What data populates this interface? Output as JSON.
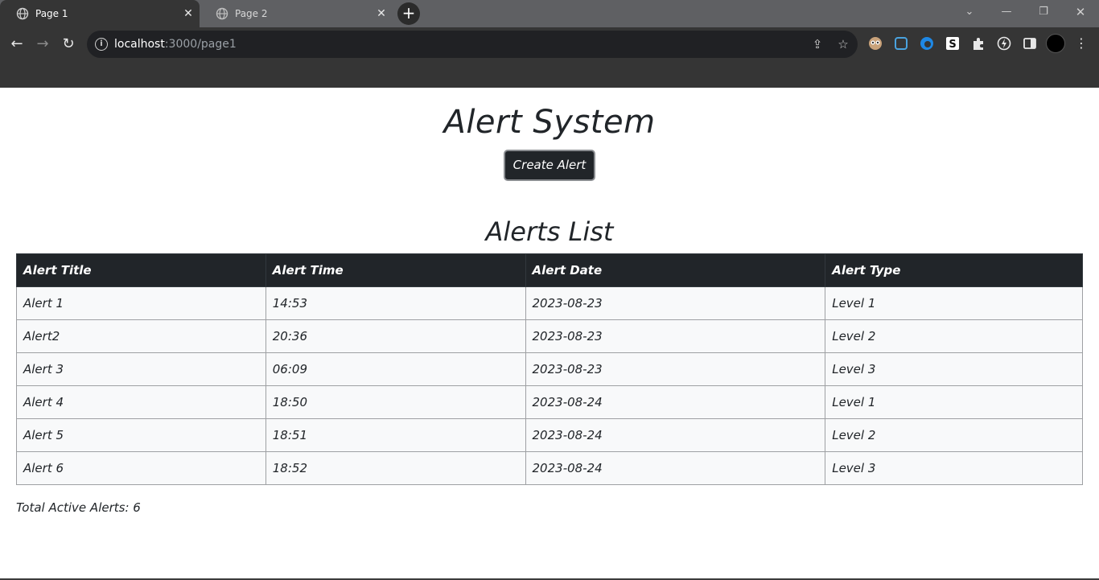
{
  "browser": {
    "tabs": [
      {
        "title": "Page 1"
      },
      {
        "title": "Page 2"
      }
    ],
    "new_tab_label": "+",
    "url_host": "localhost",
    "url_rest": ":3000/page1",
    "icons": [
      "back-icon",
      "forward-icon",
      "reload-icon",
      "info-icon",
      "share-icon",
      "star-icon",
      "extensions-icon",
      "side-panel-icon",
      "profile-avatar",
      "more-menu-icon"
    ]
  },
  "page": {
    "title": "Alert System",
    "create_button": "Create Alert",
    "list_title": "Alerts List",
    "table": {
      "headers": [
        "Alert Title",
        "Alert Time",
        "Alert Date",
        "Alert Type"
      ],
      "rows": [
        [
          "Alert 1",
          "14:53",
          "2023-08-23",
          "Level 1"
        ],
        [
          "Alert2",
          "20:36",
          "2023-08-23",
          "Level 2"
        ],
        [
          "Alert 3",
          "06:09",
          "2023-08-23",
          "Level 3"
        ],
        [
          "Alert 4",
          "18:50",
          "2023-08-24",
          "Level 1"
        ],
        [
          "Alert 5",
          "18:51",
          "2023-08-24",
          "Level 2"
        ],
        [
          "Alert 6",
          "18:52",
          "2023-08-24",
          "Level 3"
        ]
      ]
    },
    "total_text": "Total Active Alerts: 6"
  },
  "colors": {
    "header_bg": "#212529",
    "row_bg": "#f8f9fa",
    "chrome_bg": "#353535"
  }
}
